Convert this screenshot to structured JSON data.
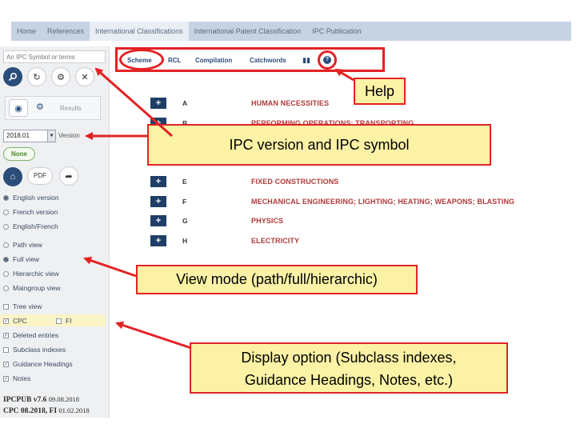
{
  "topnav": {
    "tabs": [
      "Home",
      "References",
      "International Classifications",
      "International Patent Classification",
      "IPC Publication"
    ]
  },
  "sidebar": {
    "search_placeholder": "An IPC Symbol or terms",
    "results_label": "Results",
    "version_value": "2018.01",
    "version_label": "Version",
    "none_label": "None",
    "pdf_label": "PDF",
    "language_options": [
      "English version",
      "French version",
      "English/French"
    ],
    "view_options": [
      "Path view",
      "Full view",
      "Hierarchic view",
      "Maingroup view"
    ],
    "display_options": [
      "Tree view",
      "CPC",
      "FI",
      "Deleted entries",
      "Subclass indexes",
      "Guidance Headings",
      "Notes"
    ],
    "footer_line1_title": "IPCPUB v7.6",
    "footer_line1_date": "09.08.2018",
    "footer_line2_title": "CPC 08.2018, FI",
    "footer_line2_date": "01.02.2018"
  },
  "maintabs": {
    "scheme": "Scheme",
    "rcl": "RCL",
    "compilation": "Compilation",
    "catchwords": "Catchwords"
  },
  "sections": [
    {
      "symbol": "A",
      "title": "HUMAN NECESSITIES"
    },
    {
      "symbol": "B",
      "title": "PERFORMING OPERATIONS; TRANSPORTING"
    },
    {
      "symbol": "E",
      "title": "FIXED CONSTRUCTIONS"
    },
    {
      "symbol": "F",
      "title": "MECHANICAL ENGINEERING; LIGHTING; HEATING; WEAPONS; BLASTING"
    },
    {
      "symbol": "G",
      "title": "PHYSICS"
    },
    {
      "symbol": "H",
      "title": "ELECTRICITY"
    }
  ],
  "annotations": {
    "help": "Help",
    "version_symbol": "IPC version and IPC symbol",
    "view_mode": "View mode (path/full/hierarchic)",
    "display_option_line1": "Display option (Subclass indexes,",
    "display_option_line2": "Guidance Headings, Notes, etc.)"
  },
  "colors": {
    "annotation_border": "#e32224",
    "annotation_fill": "#fbf2a6",
    "section_title": "#b03a3a",
    "plus_button": "#1f3f68"
  }
}
